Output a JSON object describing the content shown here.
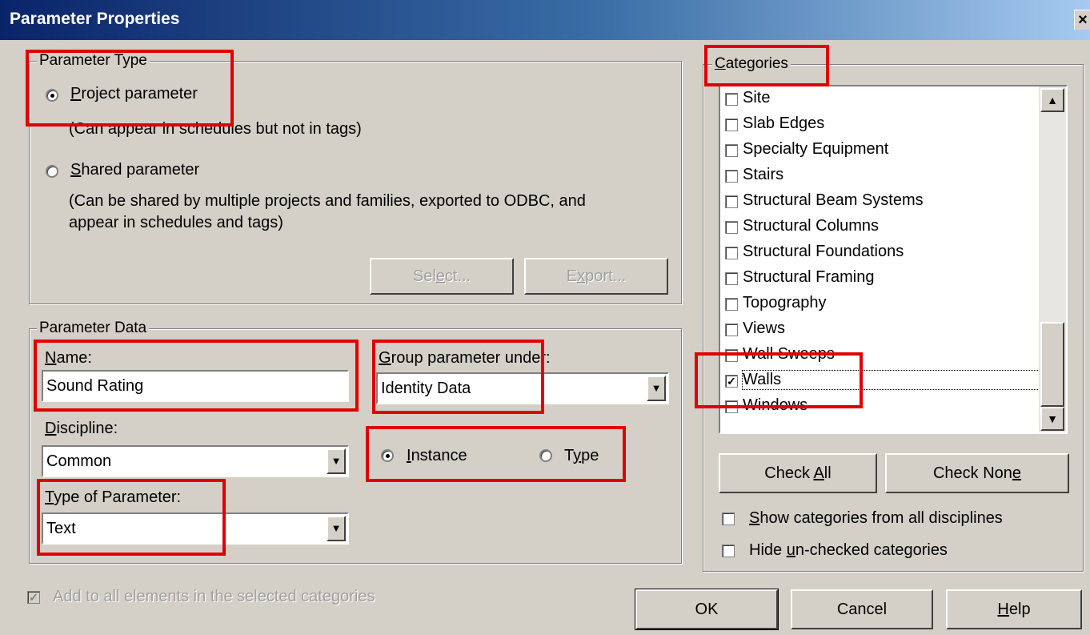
{
  "window": {
    "title": "Parameter Properties",
    "close_glyph": "×"
  },
  "parameter_type": {
    "legend": "Parameter Type",
    "project": {
      "label_mnemonic": "P",
      "label_rest": "roject parameter",
      "selected": true,
      "description": "(Can appear in schedules but not in tags)"
    },
    "shared": {
      "label_mnemonic": "S",
      "label_rest": "hared parameter",
      "selected": false,
      "description_line1": "(Can be shared by multiple projects and families, exported to ODBC, and",
      "description_line2": "appear in schedules and tags)"
    },
    "select_button": {
      "pre": "Sel",
      "mnemonic": "e",
      "post": "ct..."
    },
    "export_button": {
      "pre": "E",
      "mnemonic": "x",
      "post": "port..."
    }
  },
  "parameter_data": {
    "legend": "Parameter Data",
    "name": {
      "label_mnemonic": "N",
      "label_rest": "ame:",
      "value": "Sound Rating"
    },
    "group_under": {
      "label_mnemonic": "G",
      "label_rest": "roup parameter under:",
      "value": "Identity Data"
    },
    "discipline": {
      "label_mnemonic": "D",
      "label_rest": "iscipline:",
      "value": "Common"
    },
    "type_of_parameter": {
      "label_mnemonic": "T",
      "label_rest": "ype of Parameter:",
      "value": "Text"
    },
    "instance": {
      "label_mnemonic": "I",
      "label_rest": "nstance",
      "selected": true
    },
    "type": {
      "label_pre": "T",
      "label_mnemonic": "y",
      "label_post": "pe",
      "selected": false
    }
  },
  "add_to_all": {
    "label": "Add to all elements in the selected categories",
    "checked": true,
    "disabled": true,
    "check_glyph": "✓"
  },
  "categories": {
    "legend_mnemonic": "C",
    "legend_rest": "ategories",
    "check_glyph": "✓",
    "items": [
      {
        "label": "Site",
        "checked": false
      },
      {
        "label": "Slab Edges",
        "checked": false
      },
      {
        "label": "Specialty Equipment",
        "checked": false
      },
      {
        "label": "Stairs",
        "checked": false
      },
      {
        "label": "Structural Beam Systems",
        "checked": false
      },
      {
        "label": "Structural Columns",
        "checked": false
      },
      {
        "label": "Structural Foundations",
        "checked": false
      },
      {
        "label": "Structural Framing",
        "checked": false
      },
      {
        "label": "Topography",
        "checked": false
      },
      {
        "label": "Views",
        "checked": false
      },
      {
        "label": "Wall Sweeps",
        "checked": false
      },
      {
        "label": "Walls",
        "checked": true
      },
      {
        "label": "Windows",
        "checked": false
      }
    ],
    "check_all": {
      "pre": "Check ",
      "mnemonic": "A",
      "post": "ll"
    },
    "check_none": {
      "pre": "Check Non",
      "mnemonic": "e",
      "post": ""
    },
    "show_all_disciplines": {
      "mnemonic": "S",
      "rest": "how categories from all disciplines",
      "checked": false
    },
    "hide_unchecked": {
      "pre": "Hide ",
      "mnemonic": "u",
      "post": "n-checked categories",
      "checked": false
    }
  },
  "buttons": {
    "ok": "OK",
    "cancel": "Cancel",
    "help": {
      "mnemonic": "H",
      "rest": "elp"
    }
  },
  "scroll_arrows": {
    "up": "▲",
    "down": "▼"
  },
  "dropdown_arrow": "▼",
  "highlight_color": "#e00000"
}
